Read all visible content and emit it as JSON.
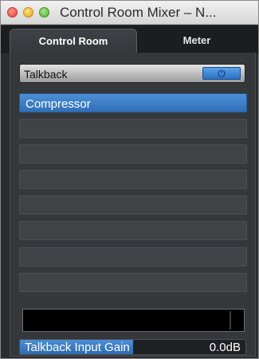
{
  "window": {
    "title": "Control Room Mixer – N..."
  },
  "tabs": [
    {
      "label": "Control Room",
      "active": true
    },
    {
      "label": "Meter",
      "active": false
    }
  ],
  "talkback": {
    "label": "Talkback",
    "power_icon": "power-icon",
    "power_glyph": "⏻",
    "power_on": true
  },
  "insert_slots": [
    {
      "label": "Compressor",
      "selected": true
    },
    {
      "label": "",
      "selected": false
    },
    {
      "label": "",
      "selected": false
    },
    {
      "label": "",
      "selected": false
    },
    {
      "label": "",
      "selected": false
    },
    {
      "label": "",
      "selected": false
    },
    {
      "label": "",
      "selected": false
    },
    {
      "label": "",
      "selected": false
    }
  ],
  "gain": {
    "label": "Talkback Input Gain",
    "value": "0.0dB",
    "fill_fraction": 0.5
  },
  "colors": {
    "accent": "#3a7cc8",
    "panel": "#34383b",
    "background": "#2a2d30"
  }
}
